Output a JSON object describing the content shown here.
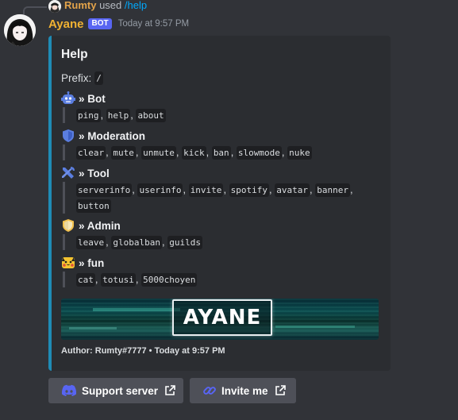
{
  "reply": {
    "username": "Rumty",
    "used_text": "used",
    "command": "/help"
  },
  "message": {
    "bot_name": "Ayane",
    "bot_tag": "BOT",
    "timestamp": "Today at 9:57 PM"
  },
  "embed": {
    "accent_color": "#1f8bb5",
    "title": "Help",
    "prefix_label": "Prefix:",
    "prefix_value": "/",
    "fields": [
      {
        "icon": "robot-icon",
        "name": "» Bot",
        "commands": [
          "ping",
          "help",
          "about"
        ]
      },
      {
        "icon": "shield-icon",
        "name": "» Moderation",
        "commands": [
          "clear",
          "mute",
          "unmute",
          "kick",
          "ban",
          "slowmode",
          "nuke"
        ]
      },
      {
        "icon": "tools-icon",
        "name": "» Tool",
        "commands": [
          "serverinfo",
          "userinfo",
          "invite",
          "spotify",
          "avatar",
          "banner",
          "button"
        ]
      },
      {
        "icon": "admin-shield-icon",
        "name": "» Admin",
        "commands": [
          "leave",
          "globalban",
          "guilds"
        ]
      },
      {
        "icon": "pikachu-icon",
        "name": "» fun",
        "commands": [
          "cat",
          "totusi",
          "5000choyen"
        ]
      }
    ],
    "image_text": "AYANE",
    "footer": "Author: Rumty#7777 • Today at 9:57 PM"
  },
  "buttons": [
    {
      "label": "Support server",
      "icon": "discord-icon"
    },
    {
      "label": "Invite me",
      "icon": "link-icon"
    }
  ],
  "colors": {
    "background": "#313338",
    "embed_background": "#2b2d31",
    "bot_name": "#f0b232",
    "bot_tag": "#5865f2",
    "button": "#4e5058",
    "link": "#00a8fc"
  }
}
